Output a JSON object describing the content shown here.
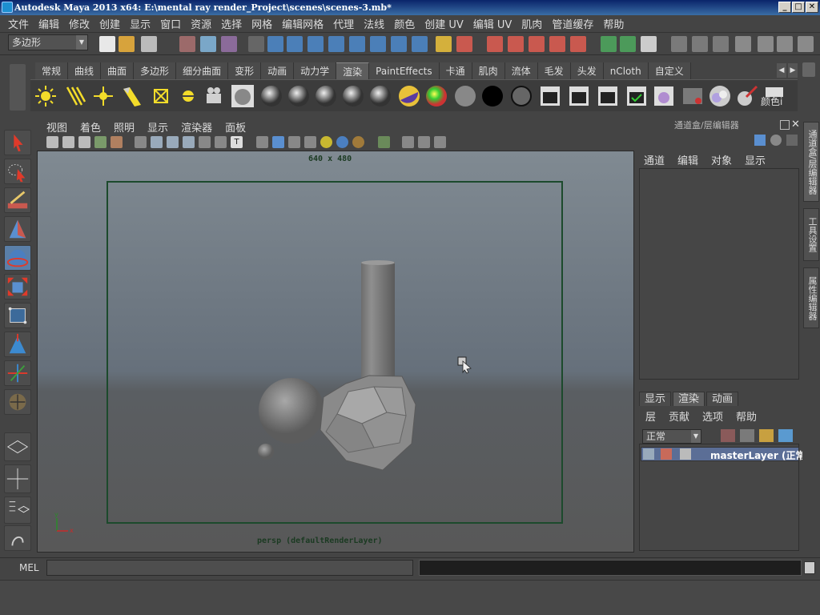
{
  "window": {
    "title": "Autodesk Maya 2013 x64: E:\\mental ray render_Project\\scenes\\scenes-3.mb*",
    "controls": [
      "_",
      "□",
      "✕"
    ]
  },
  "menubar": [
    "文件",
    "编辑",
    "修改",
    "创建",
    "显示",
    "窗口",
    "资源",
    "选择",
    "网格",
    "编辑网格",
    "代理",
    "法线",
    "颜色",
    "创建 UV",
    "编辑 UV",
    "肌肉",
    "管道缓存",
    "帮助"
  ],
  "statusline": {
    "mode": "多边形"
  },
  "shelf": {
    "tabs": [
      "常规",
      "曲线",
      "曲面",
      "多边形",
      "细分曲面",
      "变形",
      "动画",
      "动力学",
      "渲染",
      "PaintEffects",
      "卡通",
      "肌肉",
      "流体",
      "毛发",
      "头发",
      "nCloth",
      "自定义"
    ],
    "active_tab": "渲染",
    "last_icon_label": "颜色i"
  },
  "panel": {
    "menus": [
      "视图",
      "着色",
      "照明",
      "显示",
      "渲染器",
      "面板"
    ],
    "resolution": "640 x 480",
    "camera_label": "persp (defaultRenderLayer)",
    "axis_x": "x",
    "axis_y": "y"
  },
  "channelbox": {
    "title": "通道盒/层编辑器",
    "menus": [
      "通道",
      "编辑",
      "对象",
      "显示"
    ]
  },
  "layers": {
    "tabs": [
      "显示",
      "渲染",
      "动画"
    ],
    "active_tab": "渲染",
    "menus": [
      "层",
      "贡献",
      "选项",
      "帮助"
    ],
    "blend_mode": "正常",
    "master_layer": "masterLayer (正常"
  },
  "sidetabs": [
    "通道盒/层编辑器",
    "工具设置",
    "属性编辑器"
  ],
  "commandline": {
    "label": "MEL"
  }
}
